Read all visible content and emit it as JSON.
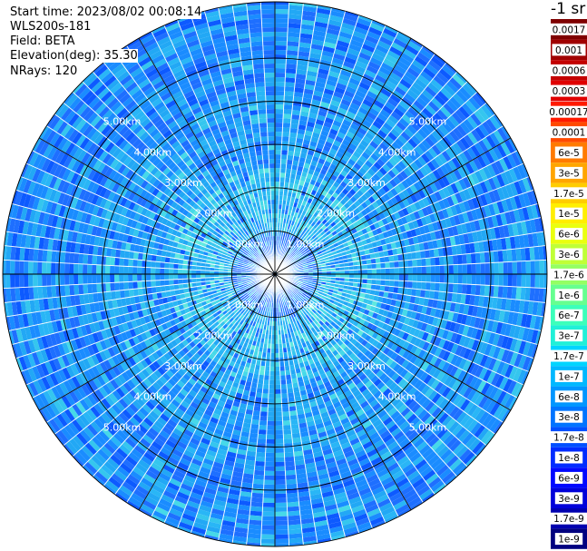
{
  "header": {
    "start_time": "Start time: 2023/08/02 00:08:14",
    "instrument": "WLS200s-181",
    "field": "Field: BETA",
    "elevation": "Elevation(deg): 35.30",
    "nrays": "NRays: 120"
  },
  "colorbar": {
    "unit": "-1 sr",
    "upper_labels": [
      "0.0017",
      "0.001",
      "0.0006",
      "0.0003"
    ],
    "upper_colors": [
      "#7f0000",
      "#a00000",
      "#c40000",
      "#e00000"
    ],
    "lower_labels": [
      "0.00017",
      "0.0001",
      "6e-5",
      "3e-5",
      "1.7e-5",
      "1e-5",
      "6e-6",
      "3e-6",
      "1.7e-6",
      "1e-6",
      "6e-7",
      "3e-7",
      "1.7e-7",
      "1e-7",
      "6e-8",
      "3e-8",
      "1.7e-8",
      "1e-8",
      "6e-9",
      "3e-9",
      "1.7e-9",
      "1e-9"
    ],
    "lower_colors": [
      "#ff1a00",
      "#ff4a00",
      "#ff7a00",
      "#ffa500",
      "#ffcc00",
      "#ffee00",
      "#eaff0f",
      "#c0ff37",
      "#94ff63",
      "#66ff90",
      "#3cffbb",
      "#20f0d8",
      "#00d4ff",
      "#00b8ff",
      "#0096ff",
      "#0074ff",
      "#0050ff",
      "#002cff",
      "#0008ff",
      "#0000da",
      "#0000b0",
      "#000080"
    ]
  },
  "chart_data": {
    "type": "heatmap",
    "projection": "polar PPI scan",
    "field": "BETA",
    "units": "-1 sr",
    "elevation_deg": 35.3,
    "n_rays": 120,
    "range_rings_km": [
      1.0,
      2.0,
      3.0,
      4.0,
      5.0
    ],
    "ring_labels": [
      "1.00km",
      "2.00km",
      "3.00km",
      "4.00km",
      "5.00km"
    ],
    "max_range_km": 6.3,
    "spokes_deg": [
      0,
      30,
      60,
      90,
      120,
      150,
      180,
      210,
      240,
      270,
      300,
      330
    ],
    "dominant_values_by_range": [
      {
        "range_km": 0.5,
        "value": "6e-8 to 1.7e-8"
      },
      {
        "range_km": 1.5,
        "value": "1.7e-7 to 6e-8"
      },
      {
        "range_km": 3.0,
        "value": "6e-8 to 3e-8"
      },
      {
        "range_km": 5.0,
        "value": "6e-8 to 1.7e-8"
      }
    ]
  }
}
